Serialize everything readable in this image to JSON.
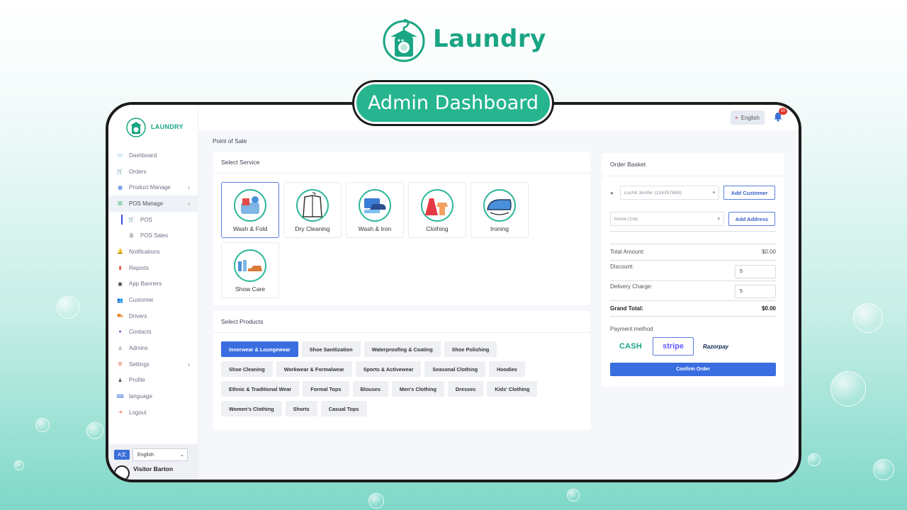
{
  "brand": {
    "name": "Laundry",
    "accent": "#1aa584"
  },
  "banner": {
    "label": "Admin Dashboard"
  },
  "sidebar": {
    "logo_text": "LAUNDRY",
    "items": [
      {
        "label": "Dashboard",
        "icon": "monitor-icon",
        "color": "#3a9ad9"
      },
      {
        "label": "Orders",
        "icon": "cart-icon",
        "color": "#e67e22"
      },
      {
        "label": "Product Manage",
        "icon": "grid-icon",
        "color": "#3b6fd8",
        "chevron": true
      },
      {
        "label": "POS Manage",
        "icon": "store-icon",
        "color": "#27ae60",
        "chevron": true,
        "active": true
      },
      {
        "label": "POS",
        "icon": "cart-icon",
        "sub": true,
        "current": true
      },
      {
        "label": "POS Sales",
        "icon": "list-icon",
        "sub": true
      },
      {
        "label": "Notifications",
        "icon": "bell-icon",
        "color": "#3b6fd8"
      },
      {
        "label": "Reports",
        "icon": "file-icon",
        "color": "#e74c3c"
      },
      {
        "label": "App Banners",
        "icon": "image-icon",
        "color": "#333"
      },
      {
        "label": "Customer",
        "icon": "users-icon",
        "color": "#e74c3c"
      },
      {
        "label": "Drivers",
        "icon": "truck-icon",
        "color": "#e67e22"
      },
      {
        "label": "Contacts",
        "icon": "chat-icon",
        "color": "#8e44ad"
      },
      {
        "label": "Admins",
        "icon": "user-tie-icon",
        "color": "#555"
      },
      {
        "label": "Settings",
        "icon": "gear-icon",
        "color": "#e74c3c",
        "chevron": true
      },
      {
        "label": "Profile",
        "icon": "user-icon",
        "color": "#555"
      },
      {
        "label": "language",
        "icon": "language-icon",
        "color": "#3b6fd8"
      },
      {
        "label": "Logout",
        "icon": "logout-icon",
        "color": "#e74c3c"
      }
    ],
    "lang_badge": "A文",
    "lang_select": "English",
    "visitor_name": "Visitor Barton"
  },
  "topbar": {
    "language_button": "English",
    "notification_count": "10"
  },
  "page": {
    "breadcrumb": "Point of Sale"
  },
  "services": {
    "title": "Select Service",
    "items": [
      {
        "label": "Wash & Fold",
        "selected": true
      },
      {
        "label": "Dry Cleaning"
      },
      {
        "label": "Wash & Iron"
      },
      {
        "label": "Clothing"
      },
      {
        "label": "Ironing"
      },
      {
        "label": "Show Care"
      }
    ]
  },
  "products": {
    "title": "Select Products",
    "items": [
      "Innerwear & Loungewear",
      "Shoe Sanitization",
      "Waterproofing & Coating",
      "Shoe Polishing",
      "Shoe Cleaning",
      "Workwear & Formalwear",
      "Sports & Activewear",
      "Seasonal Clothing",
      "Hoodies",
      "Ethnic & Traditional Wear",
      "Formal Tops",
      "Blouses",
      "Men's Clothing",
      "Dresses",
      "Kids' Clothing",
      "Women's Clothing",
      "Shorts",
      "Casual Tops"
    ],
    "active_index": 0
  },
  "basket": {
    "title": "Order Basket",
    "customer_value": "Lochit Jenifer (124357689)",
    "add_customer": "Add Customer",
    "address_value": "home (1/a)",
    "add_address": "Add Address",
    "total_label": "Total Amount:",
    "total_value": "$0.00",
    "discount_label": "Discount:",
    "discount_value": "5",
    "delivery_label": "Delivery Charge:",
    "delivery_value": "5",
    "grand_label": "Grand Total:",
    "grand_value": "$0.00",
    "payment_label": "Payment method",
    "payment_options": [
      "CASH",
      "stripe",
      "Razorpay"
    ],
    "confirm": "Confirm Order"
  }
}
